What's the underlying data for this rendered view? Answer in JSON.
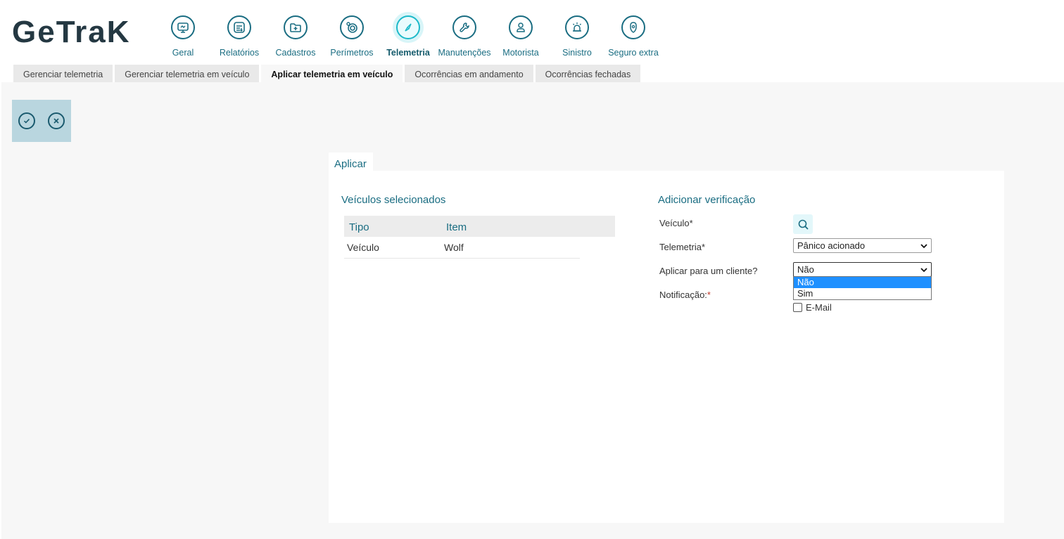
{
  "brand": {
    "logo_text": "GeTraK",
    "color": "#243842"
  },
  "nav": {
    "items": [
      {
        "label": "Geral",
        "icon": "monitor-icon"
      },
      {
        "label": "Relatórios",
        "icon": "report-icon"
      },
      {
        "label": "Cadastros",
        "icon": "folder-plus-icon"
      },
      {
        "label": "Perímetros",
        "icon": "radar-icon"
      },
      {
        "label": "Telemetria",
        "icon": "compass-icon",
        "active": true
      },
      {
        "label": "Manutenções",
        "icon": "wrench-icon"
      },
      {
        "label": "Motorista",
        "icon": "driver-icon"
      },
      {
        "label": "Sinistro",
        "icon": "siren-icon"
      },
      {
        "label": "Seguro extra",
        "icon": "shield-icon"
      }
    ]
  },
  "tabs": [
    {
      "label": "Gerenciar telemetria"
    },
    {
      "label": "Gerenciar telemetria em veículo"
    },
    {
      "label": "Aplicar telemetria em veículo",
      "active": true
    },
    {
      "label": "Ocorrências em andamento"
    },
    {
      "label": "Ocorrências fechadas"
    }
  ],
  "toolbar": {
    "confirm_icon": "check-circle-icon",
    "cancel_icon": "close-circle-icon"
  },
  "panel": {
    "tab_label": "Aplicar",
    "left": {
      "title": "Veículos selecionados",
      "columns": [
        "Tipo",
        "Item"
      ],
      "rows": [
        {
          "tipo": "Veículo",
          "item": "Wolf"
        }
      ]
    },
    "right": {
      "title": "Adicionar verificação",
      "veiculo_label": "Veículo*",
      "telemetria_label": "Telemetria*",
      "telemetria_value": "Pânico acionado",
      "cliente_label": "Aplicar para um cliente?",
      "cliente_value": "Não",
      "cliente_options": [
        "Não",
        "Sim"
      ],
      "notificacao_label": "Notificação:",
      "notificacao_req": "*",
      "email_label": "E-Mail"
    }
  },
  "colors": {
    "accent": "#1a6d82",
    "active_accent": "#1cb9c9",
    "toolbar_bg": "#b9d6df",
    "selected_option": "#1e90ff"
  }
}
